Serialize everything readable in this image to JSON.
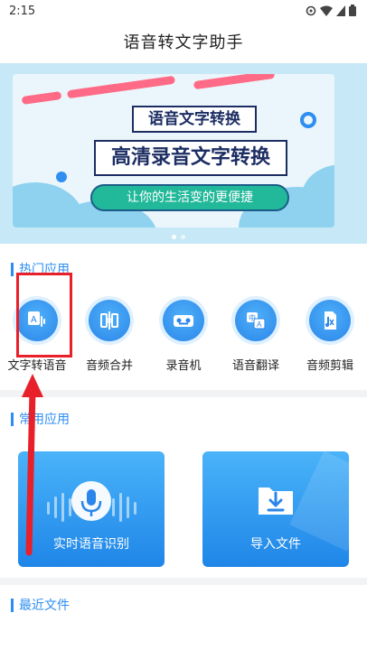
{
  "status_bar": {
    "time": "2:15"
  },
  "header": {
    "title": "语音转文字助手"
  },
  "banner": {
    "tag1": "语音文字转换",
    "tag2": "高清录音文字转换",
    "pill": "让你的生活变的更便捷"
  },
  "sections": {
    "hot": "热门应用",
    "common": "常用应用",
    "recent": "最近文件"
  },
  "hot_apps": [
    {
      "label": "文字转语音",
      "icon": "text-to-speech-icon"
    },
    {
      "label": "音频合并",
      "icon": "audio-merge-icon"
    },
    {
      "label": "录音机",
      "icon": "recorder-icon"
    },
    {
      "label": "语音翻译",
      "icon": "voice-translate-icon"
    },
    {
      "label": "音频剪辑",
      "icon": "audio-cut-icon"
    }
  ],
  "common_apps": [
    {
      "label": "实时语音识别",
      "icon": "microphone-icon"
    },
    {
      "label": "导入文件",
      "icon": "import-file-icon"
    }
  ],
  "colors": {
    "accent": "#2c8ef2",
    "highlight": "#e8202a"
  }
}
